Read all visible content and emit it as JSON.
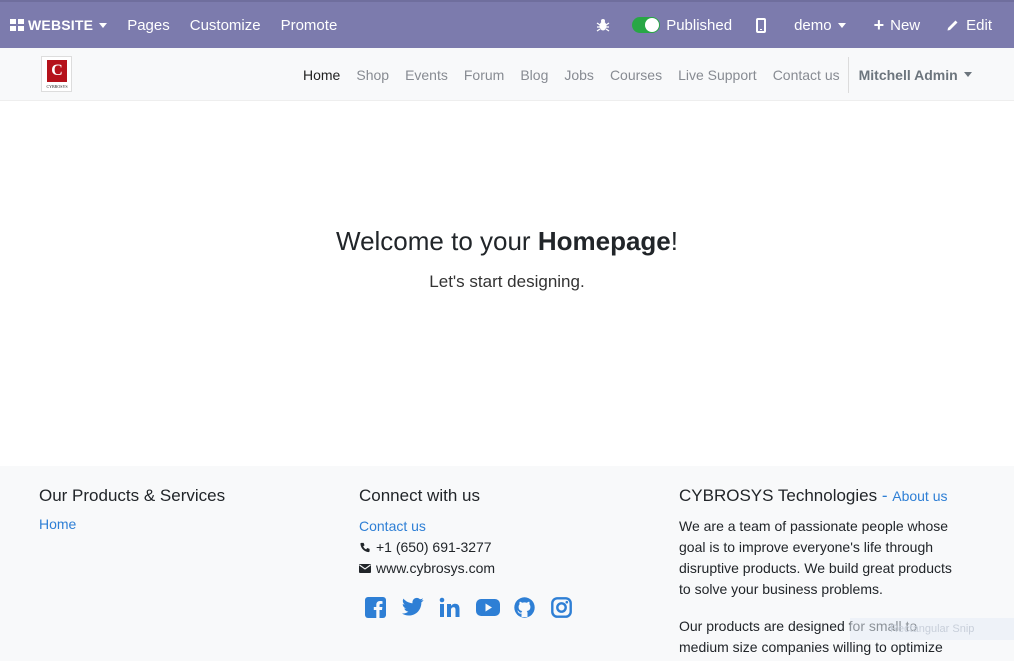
{
  "adminbar": {
    "website_label": "WEBSITE",
    "pages_label": "Pages",
    "customize_label": "Customize",
    "promote_label": "Promote",
    "published_label": "Published",
    "db_label": "demo",
    "new_label": "New",
    "edit_label": "Edit",
    "toggle_color": "#28a745",
    "bar_color": "#7c7bad"
  },
  "header": {
    "logo_letter": "C",
    "logo_text": "CYBROSYS",
    "nav": [
      "Home",
      "Shop",
      "Events",
      "Forum",
      "Blog",
      "Jobs",
      "Courses",
      "Live Support",
      "Contact us"
    ],
    "user_label": "Mitchell Admin"
  },
  "hero": {
    "title_pre": "Welcome to your ",
    "title_bold": "Homepage",
    "title_post": "!",
    "subtitle": "Let's start designing."
  },
  "footer": {
    "col1": {
      "title": "Our Products & Services",
      "link": "Home"
    },
    "col2": {
      "title": "Connect with us",
      "contact_link": "Contact us",
      "phone": "+1 (650) 691-3277",
      "website": "www.cybrosys.com",
      "social_icons": [
        "facebook-icon",
        "twitter-icon",
        "linkedin-icon",
        "youtube-icon",
        "github-icon",
        "instagram-icon"
      ]
    },
    "col3": {
      "title": "CYBROSYS Technologies",
      "title_sep": " - ",
      "about_link": "About us",
      "para1": "We are a team of passionate people whose goal is to improve everyone's life through disruptive products. We build great products to solve your business problems.",
      "para2": "Our products are designed for small to medium size companies willing to optimize"
    },
    "link_color": "#2e7fd5"
  },
  "overlay": {
    "snip_text": "Rectangular Snip"
  }
}
